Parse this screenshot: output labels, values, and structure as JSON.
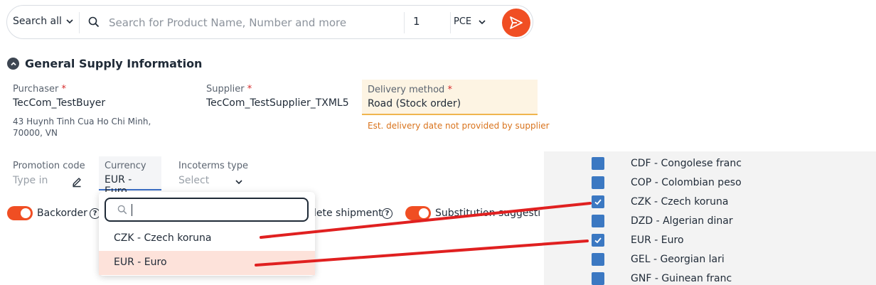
{
  "search": {
    "scope_label": "Search all",
    "placeholder": "Search for Product Name, Number and more",
    "quantity": "1",
    "unit": "PCE"
  },
  "section": {
    "title": "General Supply Information"
  },
  "purchaser": {
    "label": "Purchaser",
    "value": "TecCom_TestBuyer",
    "address": "43 Huynh Tinh Cua Ho Chi Minh, 70000, VN"
  },
  "supplier": {
    "label": "Supplier",
    "value": "TecCom_TestSupplier_TXML5"
  },
  "delivery": {
    "label": "Delivery method",
    "value": "Road (Stock order)",
    "hint": "Est. delivery date not provided by supplier"
  },
  "promotion": {
    "label": "Promotion code",
    "placeholder": "Type in"
  },
  "currency": {
    "label": "Currency",
    "value": "EUR - Euro"
  },
  "incoterms": {
    "label": "Incoterms type",
    "placeholder": "Select"
  },
  "toggles": {
    "backorder": "Backorder",
    "complete_shipment": "lete shipment",
    "substitution": "Substitution suggestio"
  },
  "help_glyph": "?",
  "required_mark": "*",
  "dropdown": {
    "options": [
      "CZK - Czech koruna",
      "EUR - Euro"
    ],
    "selected": "EUR - Euro"
  },
  "currency_list": {
    "items": [
      {
        "label": "CDF - Congolese franc",
        "checked": false
      },
      {
        "label": "COP - Colombian peso",
        "checked": false
      },
      {
        "label": "CZK - Czech koruna",
        "checked": true
      },
      {
        "label": "DZD - Algerian dinar",
        "checked": false
      },
      {
        "label": "EUR - Euro",
        "checked": true
      },
      {
        "label": "GEL - Georgian lari",
        "checked": false
      },
      {
        "label": "GNF - Guinean franc",
        "checked": false
      }
    ]
  },
  "colors": {
    "accent": "#f04e23",
    "checkbox": "#3b78c2",
    "annotation": "#e02020"
  }
}
